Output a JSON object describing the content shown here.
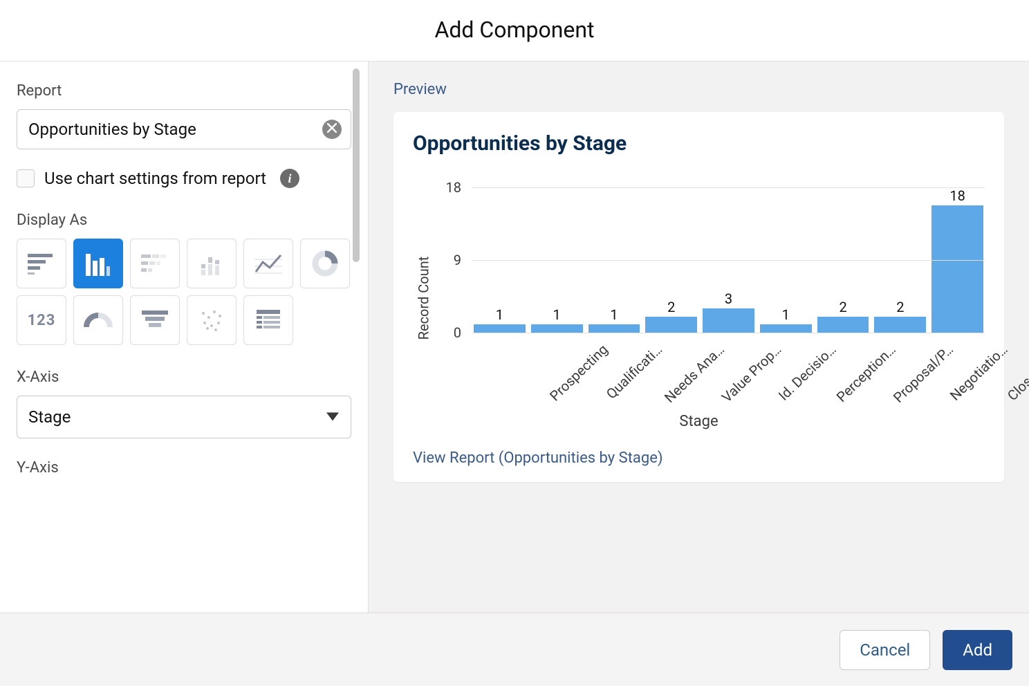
{
  "modal": {
    "title": "Add Component",
    "cancel_label": "Cancel",
    "add_label": "Add"
  },
  "report": {
    "label": "Report",
    "value": "Opportunities by Stage"
  },
  "use_chart_settings": {
    "label": "Use chart settings from report",
    "checked": false
  },
  "display_as": {
    "label": "Display As",
    "selected_index": 1
  },
  "x_axis": {
    "label": "X-Axis",
    "value": "Stage"
  },
  "y_axis": {
    "label": "Y-Axis"
  },
  "preview": {
    "label": "Preview",
    "chart_title": "Opportunities by Stage",
    "view_report_text": "View Report (Opportunities by Stage)"
  },
  "chart_data": {
    "type": "bar",
    "title": "Opportunities by Stage",
    "xlabel": "Stage",
    "ylabel": "Record Count",
    "ylim": [
      0,
      18
    ],
    "yticks": [
      0,
      9,
      18
    ],
    "categories": [
      "Prospecting",
      "Qualificati…",
      "Needs Ana…",
      "Value Prop…",
      "Id. Decisio…",
      "Perception…",
      "Proposal/P…",
      "Negotiatio…",
      "Closed Won"
    ],
    "values": [
      1,
      1,
      1,
      2,
      3,
      1,
      2,
      2,
      18
    ]
  }
}
